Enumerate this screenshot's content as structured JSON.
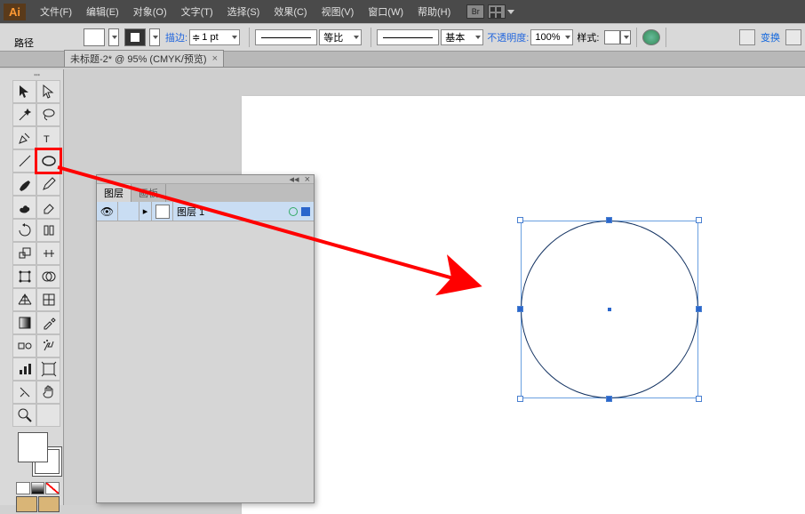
{
  "app": {
    "logo": "Ai"
  },
  "menu": {
    "file": "文件(F)",
    "edit": "编辑(E)",
    "object": "对象(O)",
    "text": "文字(T)",
    "select": "选择(S)",
    "effect": "效果(C)",
    "view": "视图(V)",
    "window": "窗口(W)",
    "help": "帮助(H)",
    "br": "Br"
  },
  "pathlabel": "路径",
  "ctrl": {
    "stroke": "描边:",
    "stroke_weight": "1 pt",
    "proportion": "等比",
    "basic": "基本",
    "opacity_label": "不透明度:",
    "opacity": "100%",
    "style": "样式:",
    "transform": "变换"
  },
  "tab": {
    "title": "未标题-2* @ 95% (CMYK/预览)"
  },
  "panel": {
    "tab1": "图层",
    "tab2": "画板",
    "layer_name": "图层 1"
  }
}
